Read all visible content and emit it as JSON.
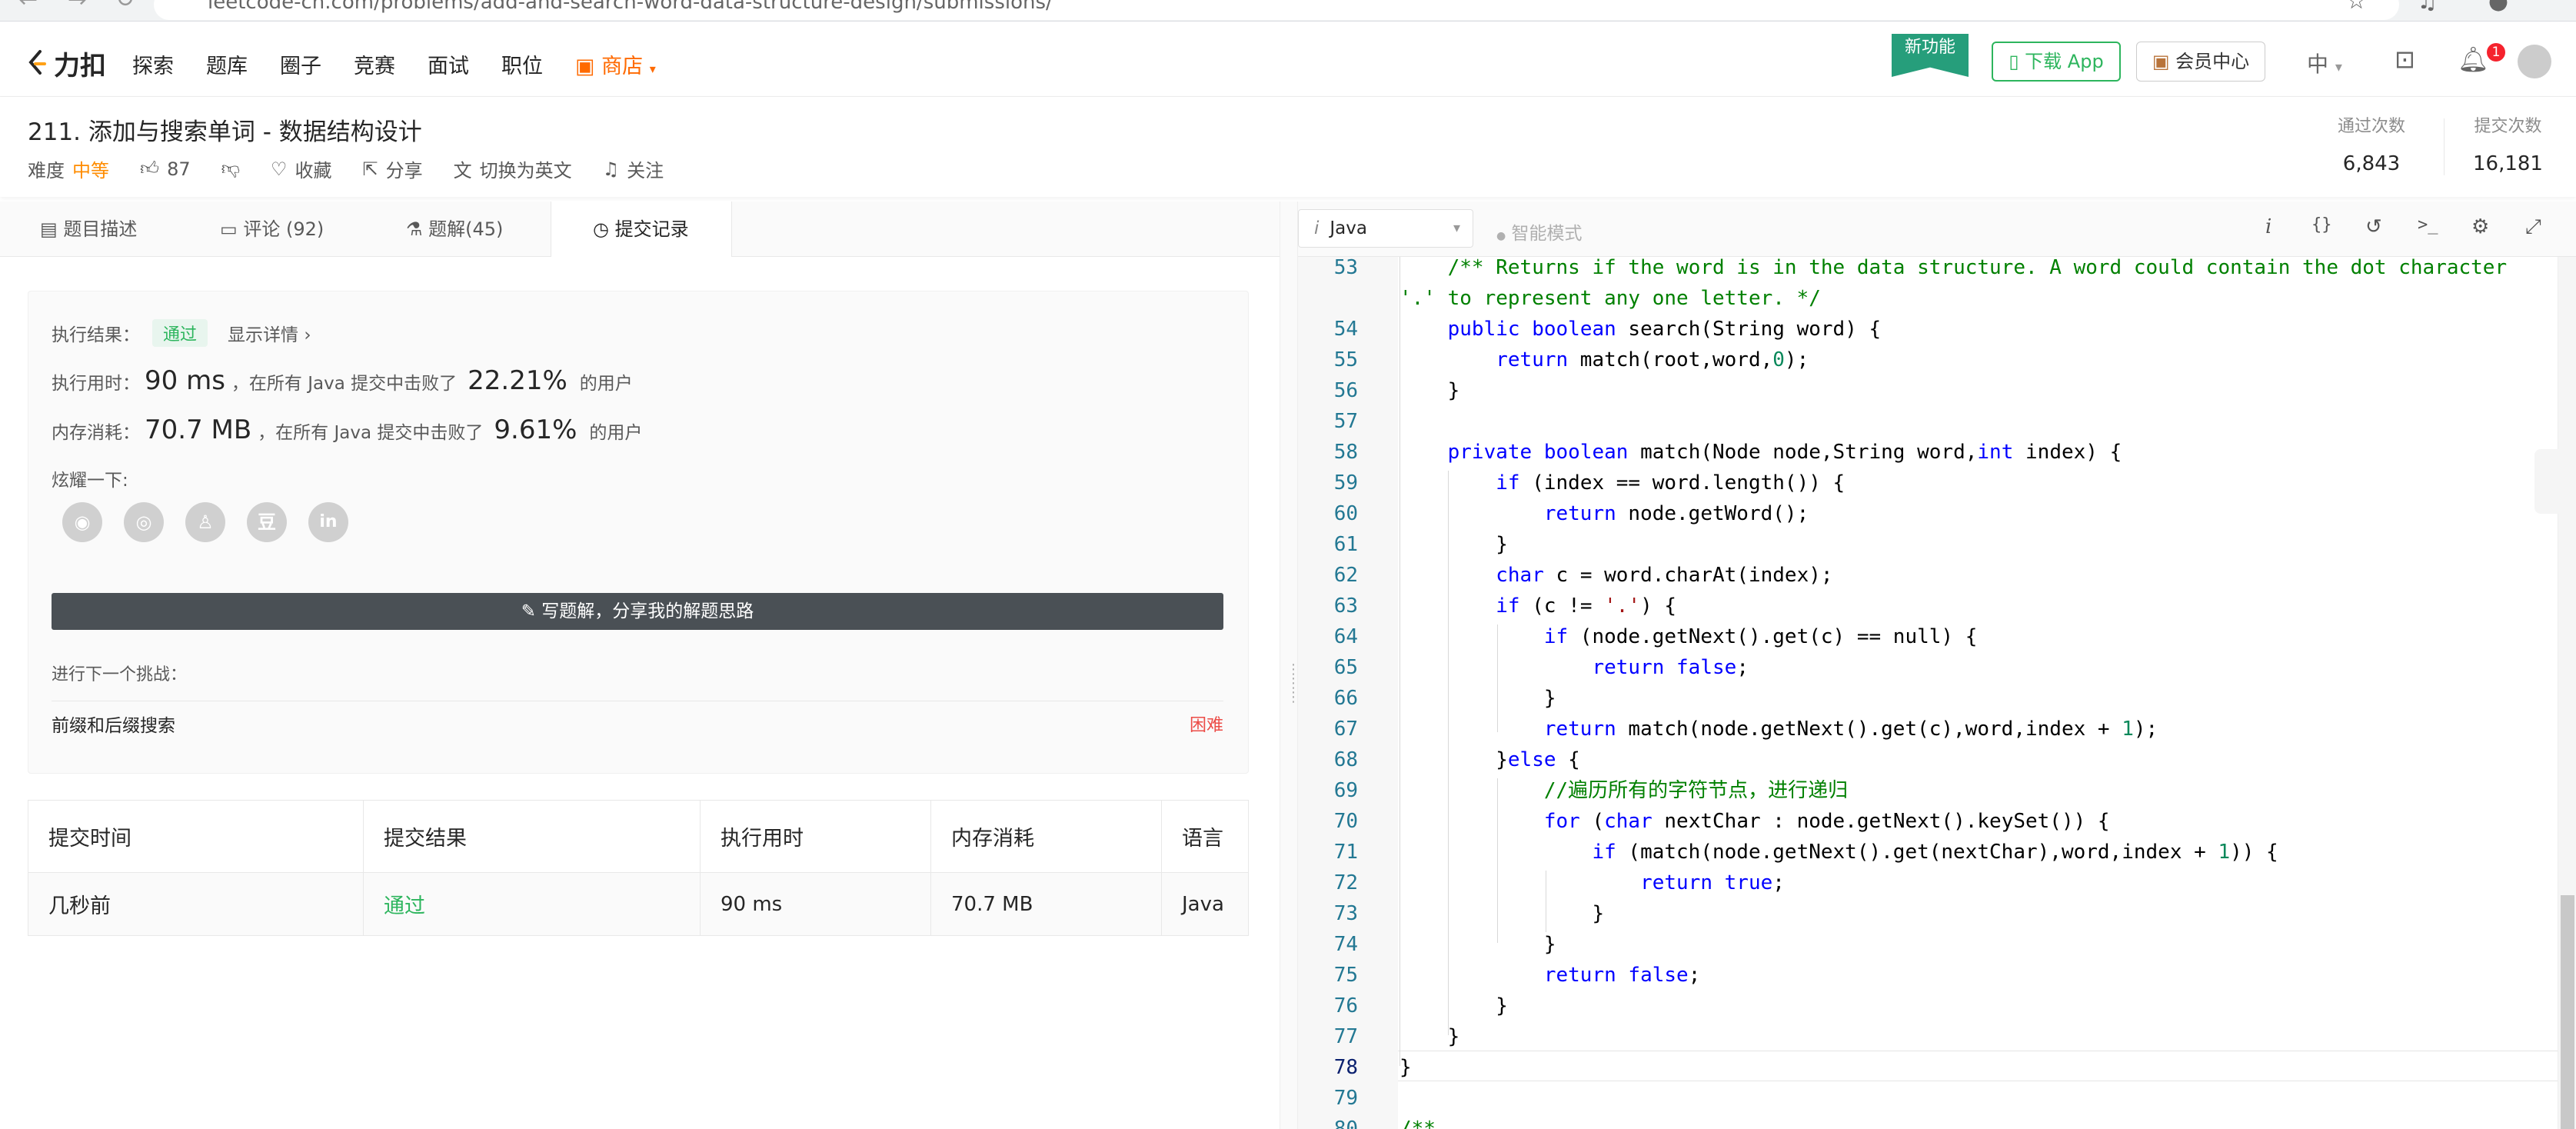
{
  "browser": {
    "url_host": "leetcode-cn.com",
    "url_path": "/problems/add-and-search-word-data-structure-design/submissions/"
  },
  "nav": {
    "logo_text": "力扣",
    "links": [
      "探索",
      "题库",
      "圈子",
      "竞赛",
      "面试",
      "职位"
    ],
    "shop": "商店",
    "new_feature": "新功能",
    "download_app": "下载 App",
    "vip": "会员中心",
    "lang": "中",
    "notification_count": "1"
  },
  "problem": {
    "title": "211. 添加与搜索单词 - 数据结构设计",
    "difficulty_label": "难度",
    "difficulty": "中等",
    "likes": "87",
    "favorite": "收藏",
    "share": "分享",
    "switch_lang": "切换为英文",
    "follow": "关注",
    "accepted_label": "通过次数",
    "accepted_value": "6,843",
    "submitted_label": "提交次数",
    "submitted_value": "16,181"
  },
  "tabs": [
    "题目描述",
    "评论 (92)",
    "题解(45)",
    "提交记录"
  ],
  "result": {
    "status_label": "执行结果：",
    "status": "通过",
    "details": "显示详情 ›",
    "time_label": "执行用时：",
    "time_value": "90 ms",
    "time_mid": "，在所有 Java 提交中击败了",
    "time_pct": "22.21%",
    "time_tail": "的用户",
    "mem_label": "内存消耗：",
    "mem_value": "70.7 MB",
    "mem_mid": "，在所有 Java 提交中击败了",
    "mem_pct": "9.61%",
    "mem_tail": "的用户",
    "share_label": "炫耀一下:",
    "share_icons": [
      "wechat-icon",
      "weibo-icon",
      "qq-icon",
      "douban-icon",
      "linkedin-icon"
    ],
    "write_button": "写题解，分享我的解题思路",
    "next_label": "进行下一个挑战：",
    "next_problem": "前缀和后缀搜索",
    "next_difficulty": "困难"
  },
  "submissions": {
    "headers": [
      "提交时间",
      "提交结果",
      "执行用时",
      "内存消耗",
      "语言"
    ],
    "rows": [
      [
        "几秒前",
        "通过",
        "90 ms",
        "70.7 MB",
        "Java"
      ]
    ]
  },
  "editor": {
    "language": "Java",
    "smart_mode": "智能模式",
    "current_line": 78
  },
  "colors": {
    "accent_green": "#2db55d",
    "difficulty_medium": "#ff8c00",
    "difficulty_hard": "#ec4c47",
    "new_feature_bg": "#269e7b",
    "shop_orange": "#ff6a00"
  }
}
